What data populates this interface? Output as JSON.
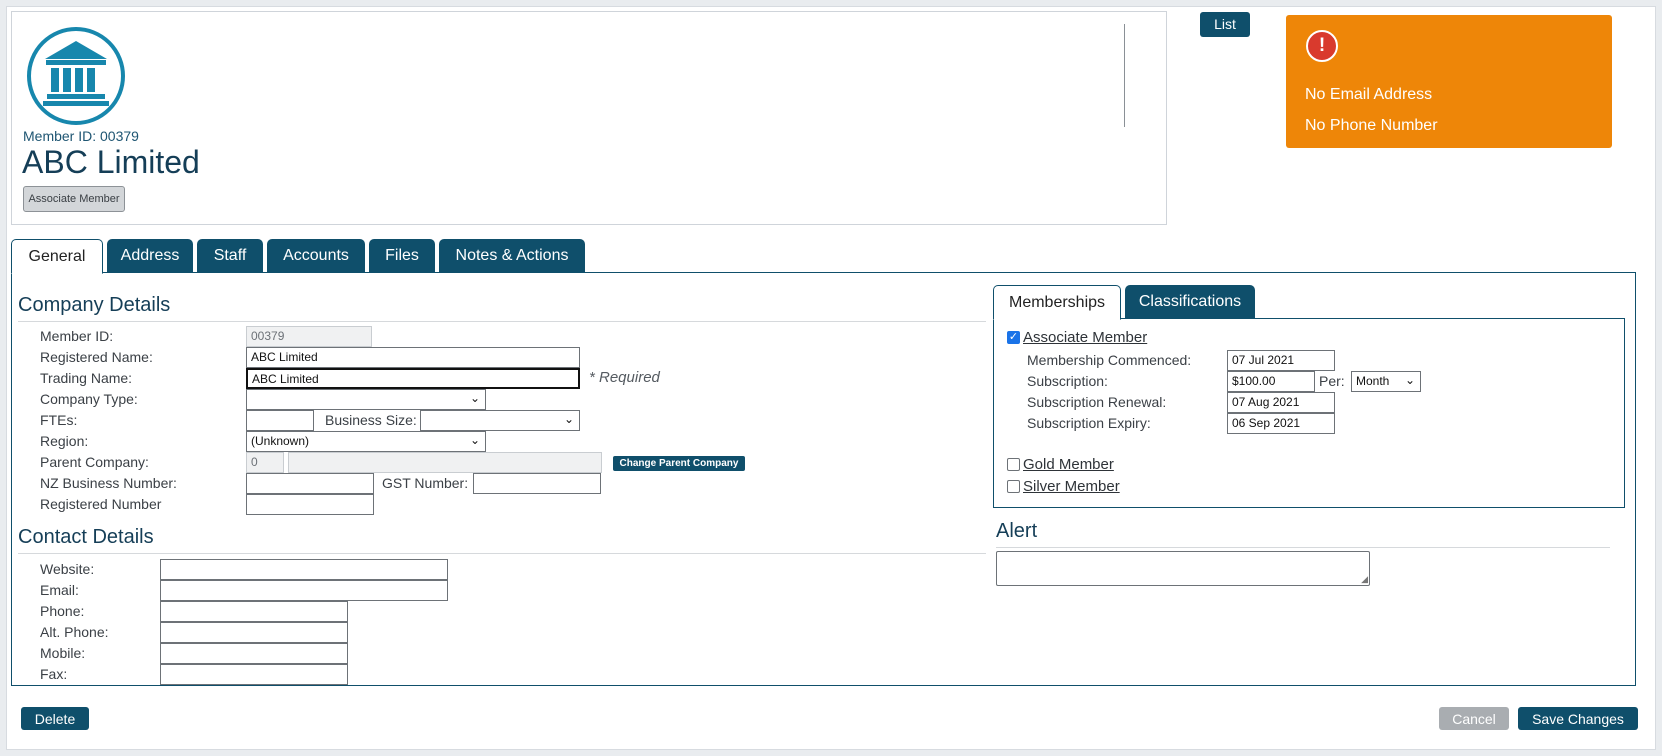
{
  "header": {
    "logo_icon": "bank-building-icon",
    "member_id_caption": "Member ID: 00379",
    "company_name": "ABC Limited",
    "member_badge": "Associate Member",
    "list_button": "List"
  },
  "alert_box": {
    "icon": "exclamation-circle-icon",
    "lines": [
      "No Email Address",
      "No Phone Number"
    ],
    "color": "#EE8608"
  },
  "tabs": [
    {
      "label": "General",
      "active": true
    },
    {
      "label": "Address"
    },
    {
      "label": "Staff"
    },
    {
      "label": "Accounts"
    },
    {
      "label": "Files"
    },
    {
      "label": "Notes & Actions"
    }
  ],
  "company_details": {
    "title": "Company Details",
    "member_id": {
      "label": "Member ID:",
      "value": "00379"
    },
    "registered_name": {
      "label": "Registered Name:",
      "value": "ABC Limited"
    },
    "trading_name": {
      "label": "Trading Name:",
      "value": "ABC Limited",
      "required_note": "* Required"
    },
    "company_type": {
      "label": "Company Type:",
      "value": ""
    },
    "ftes": {
      "label": "FTEs:",
      "value": ""
    },
    "business_size": {
      "label": "Business Size:",
      "value": ""
    },
    "region": {
      "label": "Region:",
      "value": "(Unknown)"
    },
    "parent_company": {
      "label": "Parent Company:",
      "id_value": "0",
      "name_value": "",
      "button": "Change Parent Company"
    },
    "nz_business_number": {
      "label": "NZ Business Number:",
      "value": ""
    },
    "gst_number": {
      "label": "GST Number:",
      "value": ""
    },
    "registered_number": {
      "label": "Registered Number",
      "value": ""
    }
  },
  "contact_details": {
    "title": "Contact Details",
    "website": {
      "label": "Website:",
      "value": ""
    },
    "email": {
      "label": "Email:",
      "value": ""
    },
    "phone": {
      "label": "Phone:",
      "value": ""
    },
    "alt_phone": {
      "label": "Alt. Phone:",
      "value": ""
    },
    "mobile": {
      "label": "Mobile:",
      "value": ""
    },
    "fax": {
      "label": "Fax:",
      "value": ""
    }
  },
  "side_tabs": [
    {
      "label": "Memberships",
      "active": true
    },
    {
      "label": "Classifications"
    }
  ],
  "memberships": {
    "associate": {
      "label": "Associate Member",
      "checked": true,
      "commenced": {
        "label": "Membership Commenced:",
        "value": "07 Jul 2021"
      },
      "subscription": {
        "label": "Subscription:",
        "value": "$100.00",
        "per_label": "Per:",
        "per_value": "Month"
      },
      "renewal": {
        "label": "Subscription Renewal:",
        "value": "07 Aug 2021"
      },
      "expiry": {
        "label": "Subscription Expiry:",
        "value": "06 Sep 2021"
      }
    },
    "gold": {
      "label": "Gold Member",
      "checked": false
    },
    "silver": {
      "label": "Silver Member",
      "checked": false
    }
  },
  "alert_section": {
    "title": "Alert",
    "value": ""
  },
  "footer": {
    "delete": "Delete",
    "cancel": "Cancel",
    "save": "Save Changes"
  },
  "colors": {
    "primary": "#0F4F6B",
    "logo_blue": "#1787AD",
    "alert_orange": "#EE8608",
    "disabled_grey": "#A9ADB1"
  }
}
